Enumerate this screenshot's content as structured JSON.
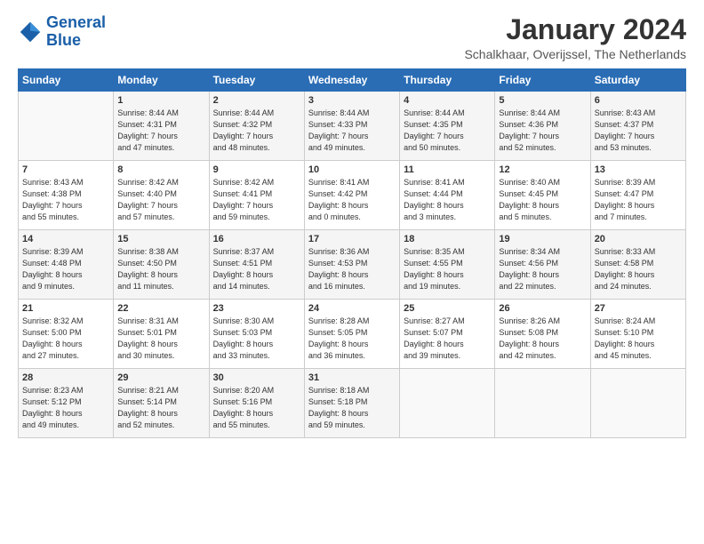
{
  "logo": {
    "line1": "General",
    "line2": "Blue"
  },
  "title": "January 2024",
  "subtitle": "Schalkhaar, Overijssel, The Netherlands",
  "days_header": [
    "Sunday",
    "Monday",
    "Tuesday",
    "Wednesday",
    "Thursday",
    "Friday",
    "Saturday"
  ],
  "weeks": [
    [
      {
        "day": "",
        "info": ""
      },
      {
        "day": "1",
        "info": "Sunrise: 8:44 AM\nSunset: 4:31 PM\nDaylight: 7 hours\nand 47 minutes."
      },
      {
        "day": "2",
        "info": "Sunrise: 8:44 AM\nSunset: 4:32 PM\nDaylight: 7 hours\nand 48 minutes."
      },
      {
        "day": "3",
        "info": "Sunrise: 8:44 AM\nSunset: 4:33 PM\nDaylight: 7 hours\nand 49 minutes."
      },
      {
        "day": "4",
        "info": "Sunrise: 8:44 AM\nSunset: 4:35 PM\nDaylight: 7 hours\nand 50 minutes."
      },
      {
        "day": "5",
        "info": "Sunrise: 8:44 AM\nSunset: 4:36 PM\nDaylight: 7 hours\nand 52 minutes."
      },
      {
        "day": "6",
        "info": "Sunrise: 8:43 AM\nSunset: 4:37 PM\nDaylight: 7 hours\nand 53 minutes."
      }
    ],
    [
      {
        "day": "7",
        "info": "Sunrise: 8:43 AM\nSunset: 4:38 PM\nDaylight: 7 hours\nand 55 minutes."
      },
      {
        "day": "8",
        "info": "Sunrise: 8:42 AM\nSunset: 4:40 PM\nDaylight: 7 hours\nand 57 minutes."
      },
      {
        "day": "9",
        "info": "Sunrise: 8:42 AM\nSunset: 4:41 PM\nDaylight: 7 hours\nand 59 minutes."
      },
      {
        "day": "10",
        "info": "Sunrise: 8:41 AM\nSunset: 4:42 PM\nDaylight: 8 hours\nand 0 minutes."
      },
      {
        "day": "11",
        "info": "Sunrise: 8:41 AM\nSunset: 4:44 PM\nDaylight: 8 hours\nand 3 minutes."
      },
      {
        "day": "12",
        "info": "Sunrise: 8:40 AM\nSunset: 4:45 PM\nDaylight: 8 hours\nand 5 minutes."
      },
      {
        "day": "13",
        "info": "Sunrise: 8:39 AM\nSunset: 4:47 PM\nDaylight: 8 hours\nand 7 minutes."
      }
    ],
    [
      {
        "day": "14",
        "info": "Sunrise: 8:39 AM\nSunset: 4:48 PM\nDaylight: 8 hours\nand 9 minutes."
      },
      {
        "day": "15",
        "info": "Sunrise: 8:38 AM\nSunset: 4:50 PM\nDaylight: 8 hours\nand 11 minutes."
      },
      {
        "day": "16",
        "info": "Sunrise: 8:37 AM\nSunset: 4:51 PM\nDaylight: 8 hours\nand 14 minutes."
      },
      {
        "day": "17",
        "info": "Sunrise: 8:36 AM\nSunset: 4:53 PM\nDaylight: 8 hours\nand 16 minutes."
      },
      {
        "day": "18",
        "info": "Sunrise: 8:35 AM\nSunset: 4:55 PM\nDaylight: 8 hours\nand 19 minutes."
      },
      {
        "day": "19",
        "info": "Sunrise: 8:34 AM\nSunset: 4:56 PM\nDaylight: 8 hours\nand 22 minutes."
      },
      {
        "day": "20",
        "info": "Sunrise: 8:33 AM\nSunset: 4:58 PM\nDaylight: 8 hours\nand 24 minutes."
      }
    ],
    [
      {
        "day": "21",
        "info": "Sunrise: 8:32 AM\nSunset: 5:00 PM\nDaylight: 8 hours\nand 27 minutes."
      },
      {
        "day": "22",
        "info": "Sunrise: 8:31 AM\nSunset: 5:01 PM\nDaylight: 8 hours\nand 30 minutes."
      },
      {
        "day": "23",
        "info": "Sunrise: 8:30 AM\nSunset: 5:03 PM\nDaylight: 8 hours\nand 33 minutes."
      },
      {
        "day": "24",
        "info": "Sunrise: 8:28 AM\nSunset: 5:05 PM\nDaylight: 8 hours\nand 36 minutes."
      },
      {
        "day": "25",
        "info": "Sunrise: 8:27 AM\nSunset: 5:07 PM\nDaylight: 8 hours\nand 39 minutes."
      },
      {
        "day": "26",
        "info": "Sunrise: 8:26 AM\nSunset: 5:08 PM\nDaylight: 8 hours\nand 42 minutes."
      },
      {
        "day": "27",
        "info": "Sunrise: 8:24 AM\nSunset: 5:10 PM\nDaylight: 8 hours\nand 45 minutes."
      }
    ],
    [
      {
        "day": "28",
        "info": "Sunrise: 8:23 AM\nSunset: 5:12 PM\nDaylight: 8 hours\nand 49 minutes."
      },
      {
        "day": "29",
        "info": "Sunrise: 8:21 AM\nSunset: 5:14 PM\nDaylight: 8 hours\nand 52 minutes."
      },
      {
        "day": "30",
        "info": "Sunrise: 8:20 AM\nSunset: 5:16 PM\nDaylight: 8 hours\nand 55 minutes."
      },
      {
        "day": "31",
        "info": "Sunrise: 8:18 AM\nSunset: 5:18 PM\nDaylight: 8 hours\nand 59 minutes."
      },
      {
        "day": "",
        "info": ""
      },
      {
        "day": "",
        "info": ""
      },
      {
        "day": "",
        "info": ""
      }
    ]
  ]
}
